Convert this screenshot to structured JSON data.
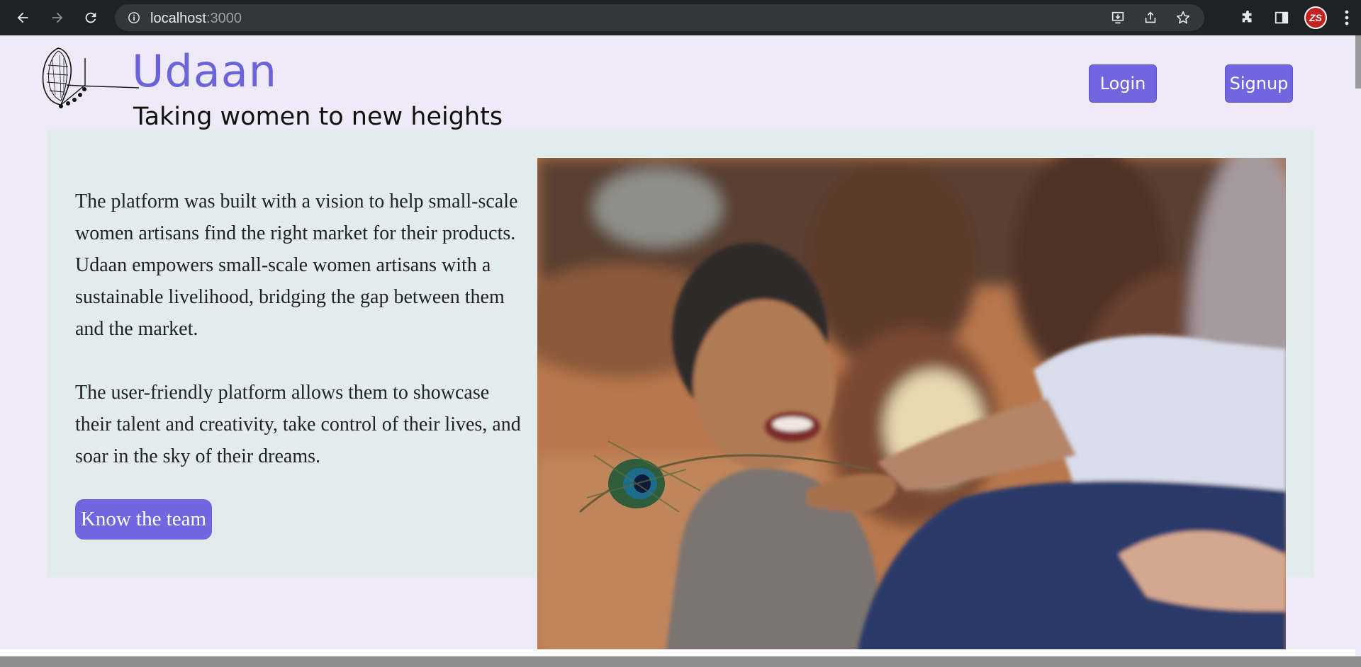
{
  "browser": {
    "url_host": "localhost",
    "url_port": ":3000",
    "profile_initials": "ZS"
  },
  "header": {
    "brand_title": "Udaan",
    "tagline": "Taking women to new heights",
    "login_label": "Login",
    "signup_label": "Signup"
  },
  "hero": {
    "paragraph_1": "The platform was built with a vision to help small-scale women artisans find the right market for their products. Udaan empowers small-scale women artisans with a sustainable livelihood, bridging the gap between them and the market.",
    "paragraph_2": "The user-friendly platform allows them to showcase their talent and creativity, take control of their lives, and soar in the sky of their dreams.",
    "team_button_label": "Know the team"
  },
  "colors": {
    "accent": "#6f66e0",
    "page_bg": "#efeaf8",
    "card_bg": "#e3ecec"
  },
  "icons": [
    "back-arrow-icon",
    "forward-arrow-icon",
    "reload-icon",
    "info-icon",
    "install-icon",
    "share-icon",
    "star-icon",
    "extensions-icon",
    "side-panel-icon",
    "menu-icon",
    "peacock-feather-logo-icon"
  ]
}
